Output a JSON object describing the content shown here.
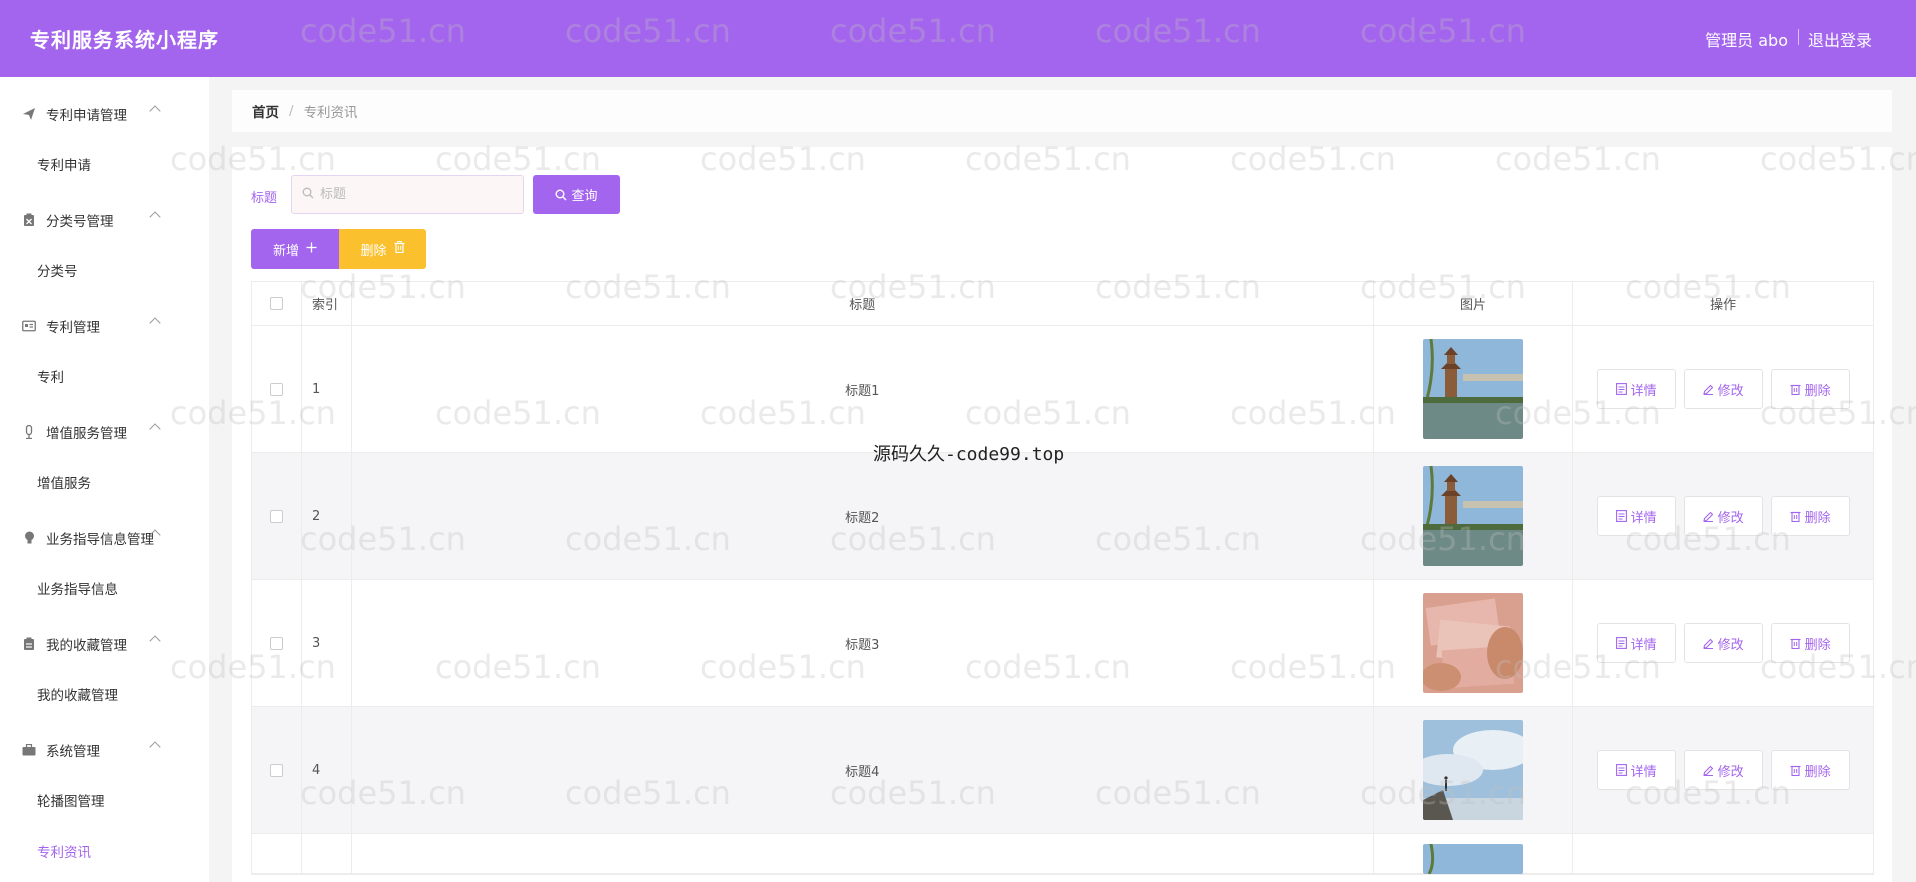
{
  "header": {
    "app_title": "专利服务系统小程序",
    "user_label": "管理员 abo",
    "logout_label": "退出登录",
    "bg_color": "#a465ee"
  },
  "sidebar": {
    "groups": [
      {
        "title": "专利申请管理",
        "icon": "paper-plane-icon",
        "item": "专利申请"
      },
      {
        "title": "分类号管理",
        "icon": "clipboard-icon",
        "item": "分类号"
      },
      {
        "title": "专利管理",
        "icon": "id-card-icon",
        "item": "专利"
      },
      {
        "title": "增值服务管理",
        "icon": "microphone-icon",
        "item": "增值服务"
      },
      {
        "title": "业务指导信息管理",
        "icon": "lightbulb-icon",
        "item": "业务指导信息"
      },
      {
        "title": "我的收藏管理",
        "icon": "clipboard-icon",
        "item": "我的收藏管理"
      },
      {
        "title": "系统管理",
        "icon": "briefcase-icon",
        "item": "轮播图管理",
        "extra_item": "专利资讯"
      }
    ],
    "active_item": "专利资讯"
  },
  "breadcrumb": {
    "home": "首页",
    "separator": "/",
    "current": "专利资讯"
  },
  "search": {
    "label": "标题",
    "placeholder": "标题",
    "query_button": "查询"
  },
  "toolbar": {
    "add_label": "新增",
    "delete_label": "删除"
  },
  "table": {
    "columns": [
      "索引",
      "标题",
      "图片",
      "操作"
    ],
    "rows": [
      {
        "index": "1",
        "title": "标题1",
        "image": "pagoda-lake"
      },
      {
        "index": "2",
        "title": "标题2",
        "image": "pagoda-lake"
      },
      {
        "index": "3",
        "title": "标题3",
        "image": "banknotes"
      },
      {
        "index": "4",
        "title": "标题4",
        "image": "cliff-sky"
      }
    ],
    "row_actions": {
      "detail": "详情",
      "edit": "修改",
      "delete": "删除"
    }
  },
  "watermark": {
    "text": "code51.cn",
    "center_text": "源码久久-code99.top"
  },
  "colors": {
    "accent": "#a465ee",
    "warning": "#fbc02d"
  }
}
